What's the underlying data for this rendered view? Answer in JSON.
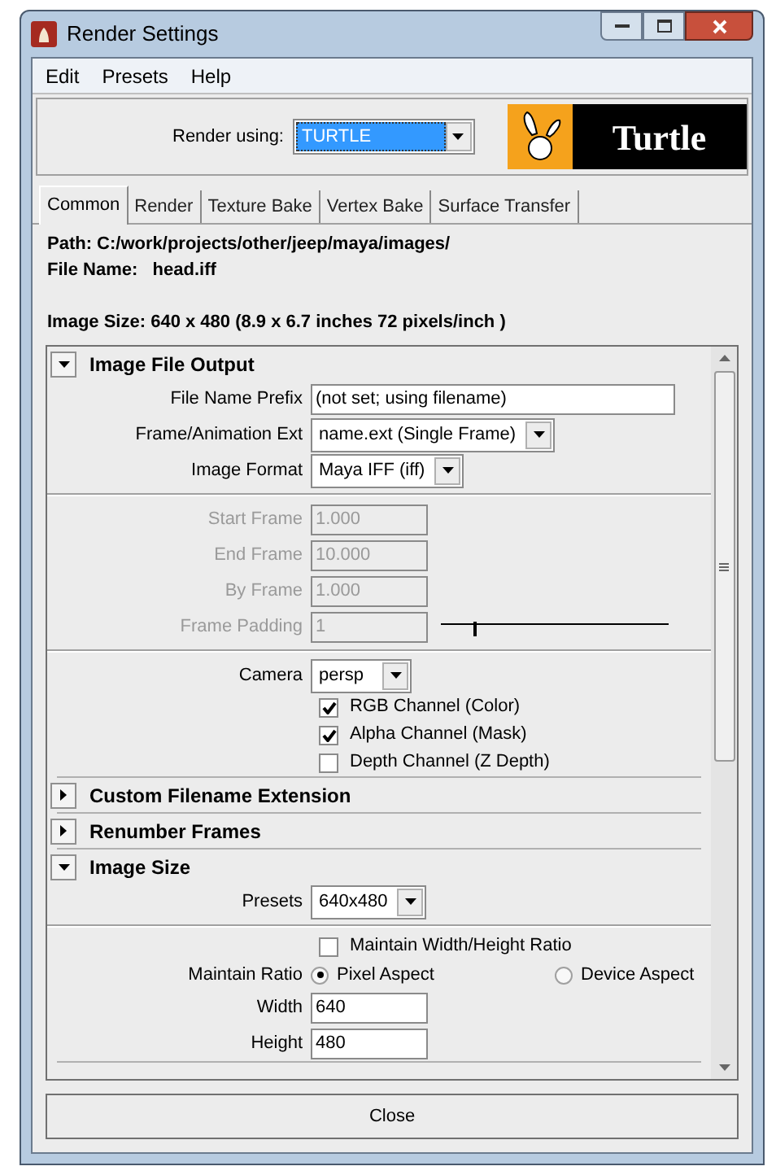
{
  "window": {
    "title": "Render Settings"
  },
  "menu": [
    "Edit",
    "Presets",
    "Help"
  ],
  "renderer": {
    "label": "Render using:",
    "value": "TURTLE"
  },
  "logo": {
    "text": "Turtle"
  },
  "tabs": [
    {
      "label": "Common",
      "selected": true
    },
    {
      "label": "Render",
      "selected": false
    },
    {
      "label": "Texture Bake",
      "selected": false
    },
    {
      "label": "Vertex Bake",
      "selected": false
    },
    {
      "label": "Surface Transfer",
      "selected": false
    }
  ],
  "info": {
    "path": "Path:  C:/work/projects/other/jeep/maya/images/",
    "file_name": "File Name:   head.iff",
    "image_size": "Image Size: 640 x 480 (8.9 x 6.7 inches 72 pixels/inch )"
  },
  "sections": [
    {
      "title": "Image File Output",
      "expanded": true,
      "rows": [
        {
          "kind": "field",
          "label": "File Name Prefix",
          "value": "(not set; using filename)",
          "disabled": false
        },
        {
          "kind": "dropdown",
          "label": "Frame/Animation Ext",
          "value": "name.ext (Single Frame)"
        },
        {
          "kind": "dropdown",
          "label": "Image Format",
          "value": "Maya IFF (iff)"
        },
        {
          "kind": "divider"
        },
        {
          "kind": "field",
          "label": "Start Frame",
          "value": "1.000",
          "disabled": true
        },
        {
          "kind": "field",
          "label": "End Frame",
          "value": "10.000",
          "disabled": true
        },
        {
          "kind": "field",
          "label": "By Frame",
          "value": "1.000",
          "disabled": true
        },
        {
          "kind": "slider",
          "label": "Frame Padding",
          "value": "1",
          "disabled": true,
          "level": 0.14
        },
        {
          "kind": "divider"
        },
        {
          "kind": "dropdown",
          "label": "Camera",
          "value": "persp"
        },
        {
          "kind": "checkbox",
          "label": "RGB Channel (Color)",
          "checked": true
        },
        {
          "kind": "checkbox",
          "label": "Alpha Channel (Mask)",
          "checked": true
        },
        {
          "kind": "checkbox",
          "label": "Depth Channel (Z Depth)",
          "checked": false
        }
      ]
    },
    {
      "title": "Custom Filename Extension",
      "expanded": false
    },
    {
      "title": "Renumber Frames",
      "expanded": false
    },
    {
      "title": "Image Size",
      "expanded": true,
      "rows": [
        {
          "kind": "dropdown",
          "label": "Presets",
          "value": "640x480"
        },
        {
          "kind": "divider"
        },
        {
          "kind": "checkbox",
          "label": "Maintain Width/Height Ratio",
          "checked": false
        },
        {
          "kind": "radio",
          "label": "Maintain Ratio",
          "options": [
            {
              "label": "Pixel Aspect",
              "selected": true
            },
            {
              "label": "Device Aspect",
              "selected": false
            }
          ]
        },
        {
          "kind": "field",
          "label": "Width",
          "value": "640",
          "disabled": false
        },
        {
          "kind": "field",
          "label": "Height",
          "value": "480",
          "disabled": false
        }
      ]
    }
  ],
  "close_button": "Close"
}
